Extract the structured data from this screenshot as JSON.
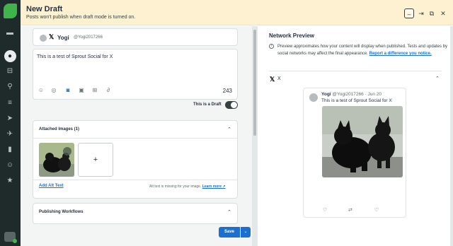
{
  "banner": {
    "title": "New Draft",
    "subtitle": "Posts won't publish when draft mode is turned on."
  },
  "composer": {
    "account_name": "Yogi",
    "account_handle": "@Yogi2017266",
    "message": "This is a test of Sprout Social for X",
    "char_count": "243",
    "draft_label": "This is a Draft",
    "draft_on": true
  },
  "attached_images": {
    "title": "Attached Images (1)",
    "add_button": "+",
    "alt_link": "Add Alt Text",
    "alt_note": "Alt text is missing for your image.",
    "alt_note_link": "Learn more ↗"
  },
  "workflows": {
    "title": "Publishing Workflows"
  },
  "save": {
    "label": "Save",
    "caret": "⌄"
  },
  "preview": {
    "title": "Network Preview",
    "description": "Preview approximates how your content will display when published. Tests and updates by social networks may affect the final appearance.",
    "report_link": "Report a difference you notice.",
    "network_label": "X",
    "tweet": {
      "name": "Yogi",
      "handle": "@Yogi2017266 · Jun 20",
      "text": "This is a test of Sprout Social for X"
    }
  },
  "colors": {
    "sidebar": "#1f2a2a",
    "brand_green": "#3fb44a",
    "banner": "#fdf1d2",
    "accent_blue": "#1b6fd1"
  }
}
